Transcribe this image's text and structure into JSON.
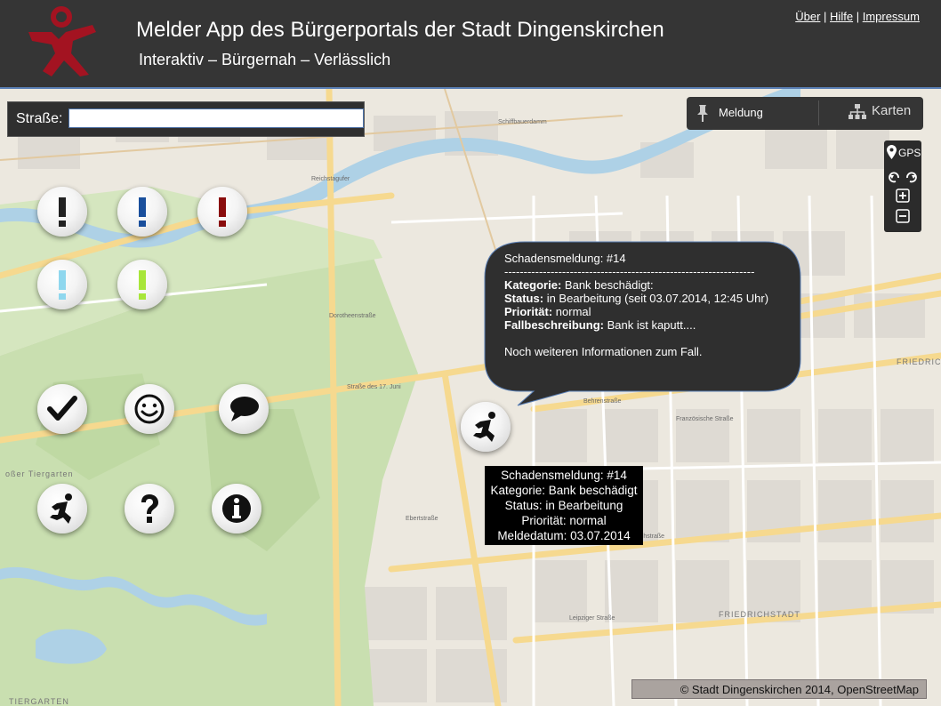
{
  "header": {
    "title": "Melder App des Bürgerportals der Stadt Dingenskirchen",
    "subtitle": "Interaktiv – Bürgernah – Verlässlich",
    "links": [
      "Über",
      "Hilfe",
      "Impressum"
    ],
    "separator": "|"
  },
  "search": {
    "label": "Straße:",
    "value": "",
    "placeholder": ""
  },
  "toolbar": {
    "select_value": "Meldung",
    "karten_label": "Karten"
  },
  "map_controls": {
    "gps_label": "GPS"
  },
  "buttons": [
    {
      "name": "alert-black-button",
      "icon": "exclamation-icon",
      "color": "#222222"
    },
    {
      "name": "alert-blue-button",
      "icon": "exclamation-icon",
      "color": "#1a4f9c"
    },
    {
      "name": "alert-red-button",
      "icon": "exclamation-icon",
      "color": "#8a0d0d"
    },
    {
      "name": "alert-lightblue-button",
      "icon": "exclamation-icon",
      "color": "#8fd7ee"
    },
    {
      "name": "alert-green-button",
      "icon": "exclamation-icon",
      "color": "#a8e63a"
    },
    {
      "name": "check-button",
      "icon": "check-icon"
    },
    {
      "name": "smiley-button",
      "icon": "smiley-icon"
    },
    {
      "name": "comment-button",
      "icon": "speech-bubble-icon"
    },
    {
      "name": "running-man-button",
      "icon": "running-man-icon"
    },
    {
      "name": "help-button",
      "icon": "question-icon"
    },
    {
      "name": "info-button",
      "icon": "info-icon"
    }
  ],
  "callout": {
    "title": "Schadensmeldung: #14",
    "divider": "-----------------------------------------------------------------",
    "kategorie_label": "Kategorie:",
    "kategorie_value": "Bank beschädigt:",
    "status_label": "Status:",
    "status_value": "in Bearbeitung (seit 03.07.2014, 12:45 Uhr)",
    "prioritaet_label": "Priorität:",
    "prioritaet_value": "normal",
    "fall_label": "Fallbeschreibung:",
    "fall_value": "Bank ist kaputt....",
    "more": "Noch weiteren Informationen zum Fall."
  },
  "tooltip": {
    "line1": "Schadensmeldung: #14",
    "line2": "Kategorie: Bank beschädigt",
    "line3": "Status: in Bearbeitung",
    "line4": "Priorität: normal",
    "line5": "Meldedatum: 03.07.2014"
  },
  "map_labels": {
    "friedrichswerder": "FRIEDRICHSWER",
    "friedrichstadt": "FRIEDRICHSTADT",
    "tiergarten": "TIERGARTEN",
    "grosser_tiergarten": "oßer Tiergarten",
    "dorotheenstr": "Dorotheenstraße",
    "franzoesische": "Französische Straße",
    "behrenstr": "Behrenstraße",
    "leipziger": "Leipziger Straße",
    "ebertstr": "Ebertstraße",
    "friedrichstr": "Friedrichstraße",
    "strasse_17": "Straße des 17. Juni",
    "schiffbauerdamm": "Schiffbauerdamm",
    "reichstagufer": "Reichstagufer"
  },
  "attribution": "© Stadt Dingenskirchen 2014, OpenStreetMap",
  "colors": {
    "header_bg": "#353535",
    "logo_red": "#a31321",
    "map_green": "#c9dfb0",
    "map_water": "#aed1e6",
    "road_yellow": "#f6d98f"
  }
}
